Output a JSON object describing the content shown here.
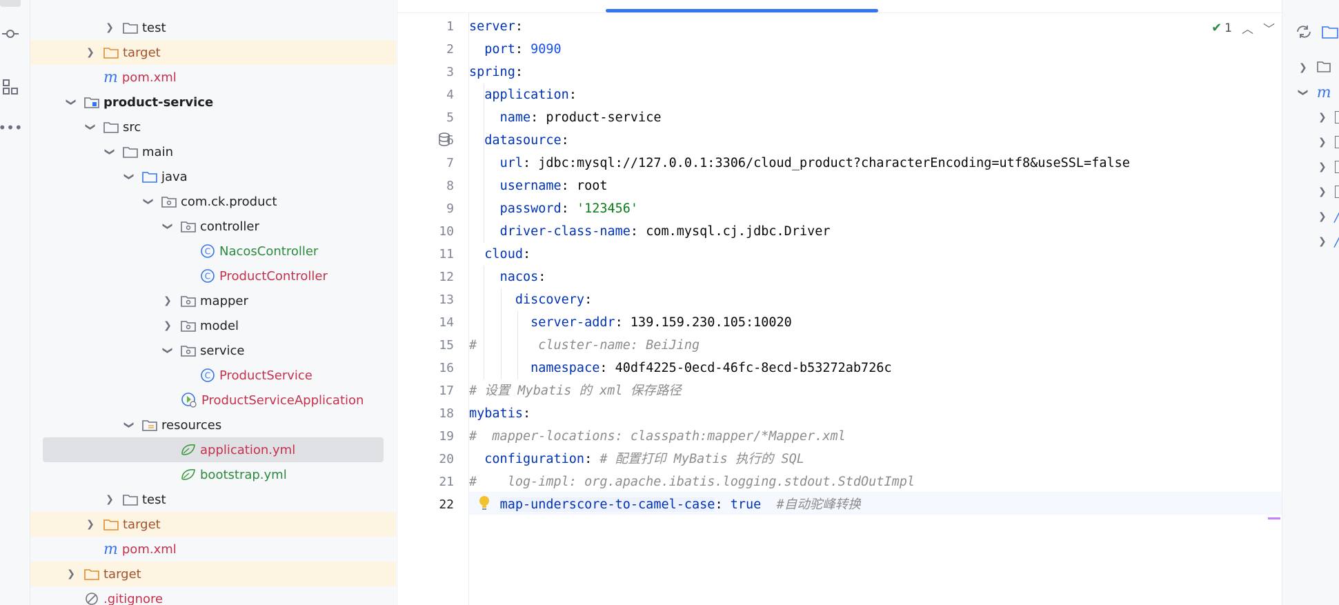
{
  "project_tree": {
    "rows": [
      {
        "label": "test",
        "type": "folder",
        "expanded": false
      },
      {
        "label": "target",
        "type": "folder-excluded",
        "expanded": false
      },
      {
        "label": "pom.xml",
        "type": "maven"
      },
      {
        "label": "product-service",
        "type": "module",
        "expanded": true
      },
      {
        "label": "src",
        "type": "folder",
        "expanded": true
      },
      {
        "label": "main",
        "type": "folder",
        "expanded": true
      },
      {
        "label": "java",
        "type": "source-root",
        "expanded": true
      },
      {
        "label": "com.ck.product",
        "type": "package",
        "expanded": true
      },
      {
        "label": "controller",
        "type": "package",
        "expanded": true
      },
      {
        "label": "NacosController",
        "type": "class"
      },
      {
        "label": "ProductController",
        "type": "class"
      },
      {
        "label": "mapper",
        "type": "package",
        "expanded": false
      },
      {
        "label": "model",
        "type": "package",
        "expanded": false
      },
      {
        "label": "service",
        "type": "package",
        "expanded": true
      },
      {
        "label": "ProductService",
        "type": "class"
      },
      {
        "label": "ProductServiceApplication",
        "type": "spring-app"
      },
      {
        "label": "resources",
        "type": "resources-root",
        "expanded": true
      },
      {
        "label": "application.yml",
        "type": "yaml"
      },
      {
        "label": "bootstrap.yml",
        "type": "yaml"
      },
      {
        "label": "test",
        "type": "folder",
        "expanded": false
      },
      {
        "label": "target",
        "type": "folder-excluded",
        "expanded": false
      },
      {
        "label": "pom.xml",
        "type": "maven"
      },
      {
        "label": "target",
        "type": "folder-excluded",
        "expanded": false
      },
      {
        "label": ".gitignore",
        "type": "ignored"
      }
    ]
  },
  "editor": {
    "inspection_count": "1",
    "current_line": 22,
    "lines": [
      {
        "n": "1"
      },
      {
        "n": "2"
      },
      {
        "n": "3"
      },
      {
        "n": "4"
      },
      {
        "n": "5"
      },
      {
        "n": "6"
      },
      {
        "n": "7"
      },
      {
        "n": "8"
      },
      {
        "n": "9"
      },
      {
        "n": "10"
      },
      {
        "n": "11"
      },
      {
        "n": "12"
      },
      {
        "n": "13"
      },
      {
        "n": "14"
      },
      {
        "n": "15"
      },
      {
        "n": "16"
      },
      {
        "n": "17"
      },
      {
        "n": "18"
      },
      {
        "n": "19"
      },
      {
        "n": "20"
      },
      {
        "n": "21"
      },
      {
        "n": "22"
      }
    ],
    "code": {
      "l1_key": "server",
      "l2_key": "port",
      "l2_val": "9090",
      "l3_key": "spring",
      "l4_key": "application",
      "l5_key": "name",
      "l5_val": "product-service",
      "l6_key": "datasource",
      "l7_key": "url",
      "l7_val": "jdbc:mysql://127.0.0.1:3306/cloud_product?characterEncoding=utf8&useSSL=false",
      "l8_key": "username",
      "l8_val": "root",
      "l9_key": "password",
      "l9_val": "'123456'",
      "l10_key": "driver-class-name",
      "l10_val": "com.mysql.cj.jdbc.Driver",
      "l11_key": "cloud",
      "l12_key": "nacos",
      "l13_key": "discovery",
      "l14_key": "server-addr",
      "l14_val": "139.159.230.105:10020",
      "l15_comment": "#        cluster-name: BeiJing",
      "l16_key": "namespace",
      "l16_val": "40df4225-0ecd-46fc-8ecd-b53272ab726c",
      "l17_comment": "# 设置 Mybatis 的 xml 保存路径",
      "l18_key": "mybatis",
      "l19_comment": "#  mapper-locations: classpath:mapper/*Mapper.xml",
      "l20_key": "configuration",
      "l20_comment": "# 配置打印 MyBatis 执行的 SQL",
      "l21_comment": "#    log-impl: org.apache.ibatis.logging.stdout.StdOutImpl",
      "l22_key": "map-underscore-to-camel-case",
      "l22_val": "true",
      "l22_comment": "#自动驼峰转换"
    }
  },
  "colors": {
    "accent": "#3574f0",
    "excluded_bg": "#fdf5e1",
    "selected_bg": "#dfe1e5",
    "yaml_key": "#0033b3",
    "yaml_number": "#1750eb",
    "yaml_string": "#067d17",
    "comment": "#8c8c8c"
  }
}
